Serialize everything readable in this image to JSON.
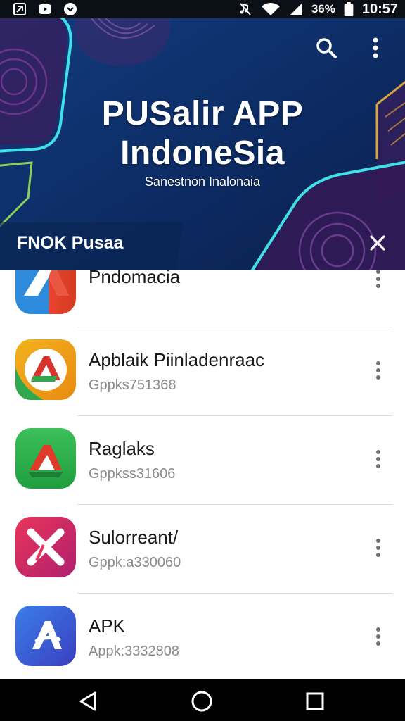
{
  "status_bar": {
    "battery": "36%",
    "time": "10:57",
    "icons": [
      "notification-app-icon",
      "youtube-icon",
      "chat-icon",
      "mute-icon",
      "wifi-icon",
      "signal-icon",
      "battery-icon"
    ]
  },
  "header": {
    "title_line1": "PUSalir APP",
    "title_line2": "IndoneSia",
    "subtitle": "Sanestnon Inalonaia",
    "section_label": "FNOK Pusaa",
    "actions": [
      "search-icon",
      "more-vert-icon",
      "close-icon"
    ],
    "colors": {
      "background": "#0d2d66",
      "accent": "#3fe0e8"
    }
  },
  "apps": [
    {
      "name": "Pndomacia",
      "package": ""
    },
    {
      "name": "Apblaik Piinladenraac",
      "package": "Gppks751368"
    },
    {
      "name": "Raglaks",
      "package": "Gppkss31606"
    },
    {
      "name": "Sulorreant/",
      "package": "Gppk:a330060"
    },
    {
      "name": "APK",
      "package": "Appk:3332808"
    }
  ],
  "navbar": {
    "buttons": [
      "back-icon",
      "home-icon",
      "recents-icon"
    ]
  }
}
